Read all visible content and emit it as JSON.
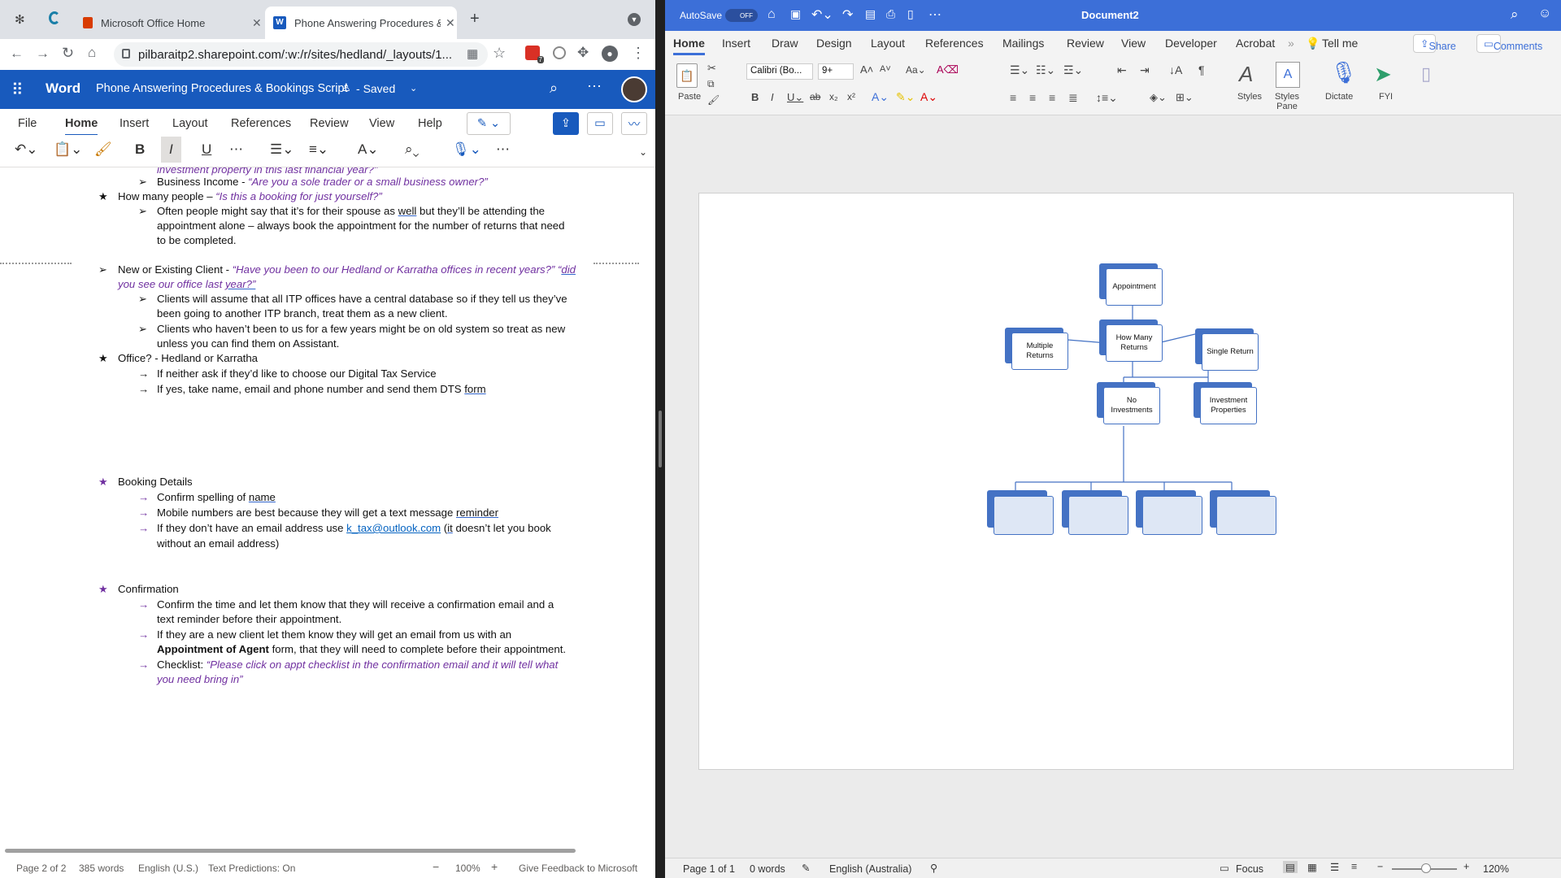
{
  "browser": {
    "tabs": [
      {
        "title": "Microsoft Office Home"
      },
      {
        "title": "Phone Answering Procedures &"
      }
    ],
    "url": "pilbaraitp2.sharepoint.com/:w:/r/sites/hedland/_layouts/1...",
    "badge": "7"
  },
  "word_online": {
    "app_name": "Word",
    "doc_title": "Phone Answering Procedures & Bookings Script",
    "save_state": "Saved",
    "ribbon_tabs": [
      "File",
      "Home",
      "Insert",
      "Layout",
      "References",
      "Review",
      "View",
      "Help"
    ],
    "active_tab": "Home",
    "format_buttons": {
      "bold": "B",
      "italic": "I",
      "underline": "U"
    },
    "status": {
      "page": "Page 2 of 2",
      "words": "385 words",
      "language": "English (U.S.)",
      "predictions": "Text Predictions: On",
      "zoom": "100%",
      "feedback": "Give Feedback to Microsoft"
    }
  },
  "document": {
    "top_partial": "investment property in this last financial year?\"",
    "business_income_label": "Business Income - ",
    "business_income_q": "“Are you a sole trader or a small business owner?”",
    "how_many_label": "How many people – ",
    "how_many_q": "“Is this a booking for just yourself?”",
    "spouse_1a": "Often people might say that it’s for their spouse as ",
    "spouse_1b": "well",
    "spouse_1c": " but they’ll be attending the",
    "spouse_2": "appointment alone – always book the appointment for the number of returns that need",
    "spouse_3": "to be completed.",
    "new_existing_label": "New or Existing Client - ",
    "new_existing_q1": "“Have you been to our Hedland or Karratha offices in recent years?” “",
    "new_existing_q1b": "did",
    "new_existing_q2a": "you see our office last ",
    "new_existing_q2b": "year?”",
    "central_db_1": "Clients will assume that all ITP offices have a central database so if they tell us they’ve",
    "central_db_2": "been going to another ITP branch, treat them as a new client.",
    "old_system_1": "Clients who haven’t been to us for a few years might be on old system so treat as new",
    "old_system_2": "unless you can find them on Assistant.",
    "office_label": "Office? - Hedland or Karratha",
    "neither": "If neither ask if they’d like to choose our Digital Tax Service",
    "yes_take_a": "If yes, take name, email and phone number and send them DTS ",
    "yes_take_b": "form",
    "booking_details": "Booking Details",
    "confirm_spelling_a": "Confirm spelling of ",
    "confirm_spelling_b": "name",
    "mobile_a": "Mobile numbers are best because they will get a text message ",
    "mobile_b": "reminder",
    "email_a": "If they don’t have an email address use ",
    "email_link": "k_tax@outlook.com",
    "email_b": " (",
    "email_c": "it",
    "email_d": " doesn’t let you book",
    "email_2": "without an email address)",
    "confirmation": "Confirmation",
    "confirm_time_1": "Confirm the time and let them know that they will receive a confirmation email and a",
    "confirm_time_2": "text reminder before their appointment.",
    "new_client_1": "If they are a new client let them know they will get an email from us with an",
    "new_client_2a": "Appointment of Agent",
    "new_client_2b": " form, that they will need to complete before their appointment.",
    "checklist_label": "Checklist: ",
    "checklist_q1": "“Please click on appt checklist in the confirmation email and it will tell what",
    "checklist_q2": "you need bring in”"
  },
  "word_mac": {
    "autosave": "AutoSave",
    "autosave_state": "OFF",
    "doc_title": "Document2",
    "tabs": [
      "Home",
      "Insert",
      "Draw",
      "Design",
      "Layout",
      "References",
      "Mailings",
      "Review",
      "View",
      "Developer",
      "Acrobat"
    ],
    "tell_me": "Tell me",
    "share": "Share",
    "comments": "Comments",
    "paste": "Paste",
    "font": "Calibri (Bo...",
    "font_size": "9+",
    "styles": "Styles",
    "styles_pane_1": "Styles",
    "styles_pane_2": "Pane",
    "dictate": "Dictate",
    "fyi": "FYI",
    "status": {
      "page": "Page 1 of 1",
      "words": "0 words",
      "language": "English (Australia)",
      "focus": "Focus",
      "zoom": "120%"
    }
  },
  "diagram": {
    "appointment": "Appointment",
    "multiple_returns_1": "Multiple",
    "multiple_returns_2": "Returns",
    "how_many_returns_1": "How Many",
    "how_many_returns_2": "Returns",
    "single_return": "Single Return",
    "no_investments_1": "No",
    "no_investments_2": "Investments",
    "investment_properties_1": "Investment",
    "investment_properties_2": "Properties"
  },
  "colors": {
    "word_blue": "#185abd",
    "mac_title": "#3c6fd8",
    "accent_purple": "#7030a0",
    "smartart_blue": "#4472c4"
  }
}
